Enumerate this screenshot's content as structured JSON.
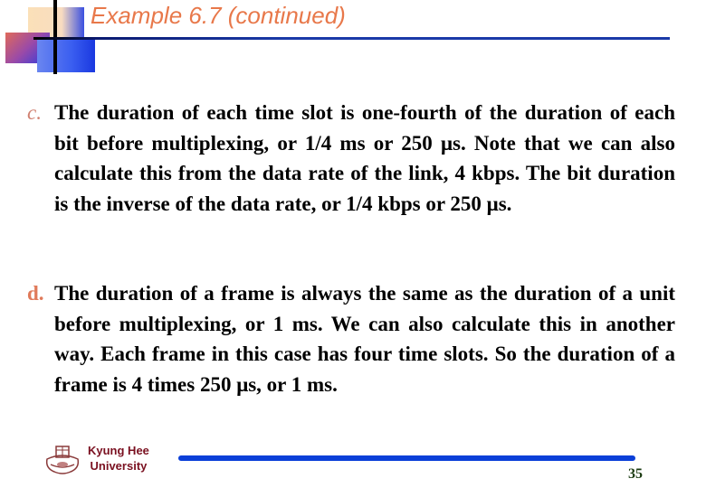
{
  "slide": {
    "title": "Example 6.7 (continued)",
    "items": [
      {
        "marker": "c.",
        "text": "The duration of each time slot is one-fourth of the duration of each bit before multiplexing, or 1/4 ms or 250 μs. Note that we can also calculate this from the data rate of the link, 4 kbps. The bit duration is the inverse of the data rate, or 1/4 kbps or 250 μs."
      },
      {
        "marker": "d.",
        "text": "The duration of a frame is always the same as the duration of a unit before multiplexing, or 1 ms. We can also calculate this in another way. Each frame in this case has four time slots. So the duration of a frame is 4 times 250 μs, or 1 ms."
      }
    ]
  },
  "footer": {
    "university_line1": "Kyung Hee",
    "university_line2": "University",
    "logo_icon": "university-crest-icon",
    "page_number": "35"
  },
  "colors": {
    "title": "#e8784a",
    "accent_bar": "#0a3fd8",
    "university_text": "#7a1020"
  }
}
